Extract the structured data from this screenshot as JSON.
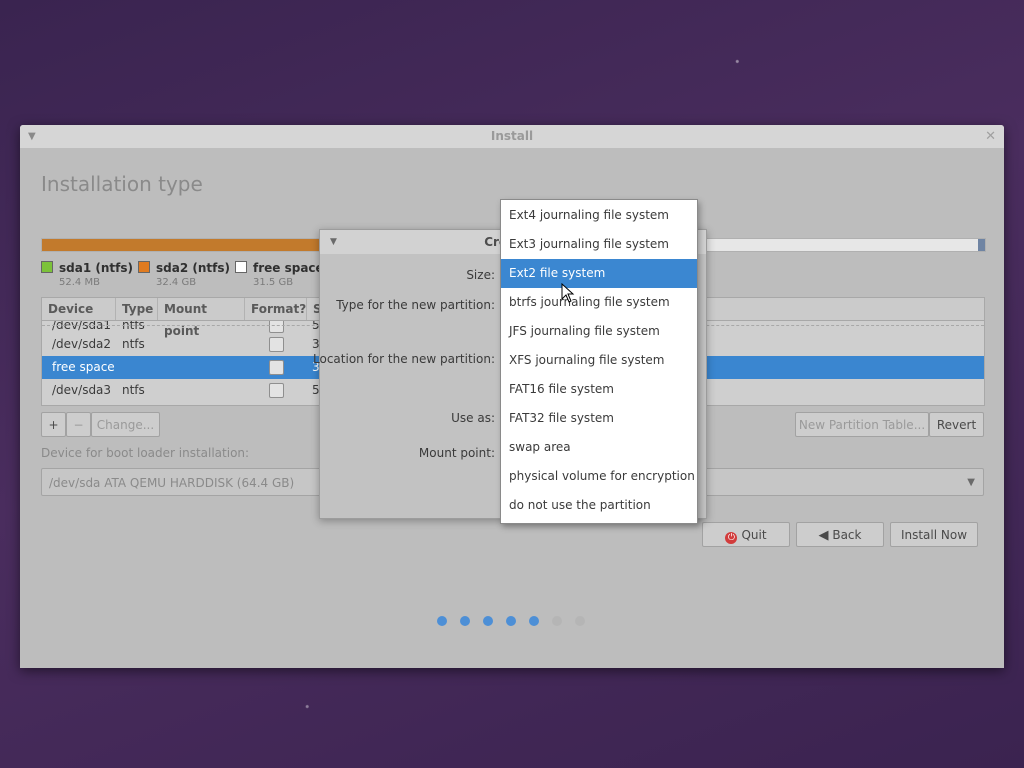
{
  "window": {
    "title": "Install"
  },
  "page": {
    "title": "Installation type"
  },
  "legend": [
    {
      "name": "sda1 (ntfs)",
      "size": "52.4 MB",
      "color": "#7cc23a"
    },
    {
      "name": "sda2 (ntfs)",
      "size": "32.4 GB",
      "color": "#e07b20"
    },
    {
      "name": "free space",
      "size": "31.5 GB",
      "color": "#ffffff"
    }
  ],
  "table": {
    "headers": {
      "device": "Device",
      "type": "Type",
      "mount": "Mount point",
      "format": "Format?",
      "size": "S"
    },
    "rows": [
      {
        "device": "/dev/sda1",
        "type": "ntfs",
        "size": "5"
      },
      {
        "device": "/dev/sda2",
        "type": "ntfs",
        "size": "3"
      },
      {
        "device": "free space",
        "type": "",
        "size": "3"
      },
      {
        "device": "/dev/sda3",
        "type": "ntfs",
        "size": "5"
      }
    ]
  },
  "buttons": {
    "add": "+",
    "remove": "−",
    "change": "Change...",
    "new_table": "New Partition Table...",
    "revert": "Revert",
    "quit": "Quit",
    "back": "Back",
    "install": "Install Now"
  },
  "bootloader": {
    "label": "Device for boot loader installation:",
    "value": "/dev/sda    ATA QEMU HARDDISK (64.4 GB)"
  },
  "progress": {
    "steps_total": 7,
    "steps_done": 5
  },
  "dialog": {
    "title": "Create p",
    "labels": {
      "size": "Size:",
      "type": "Type for the new partition:",
      "location": "Location for the new partition:",
      "use_as": "Use as:",
      "mount": "Mount point:"
    }
  },
  "dropdown": {
    "selected_index": 2,
    "options": [
      "Ext4 journaling file system",
      "Ext3 journaling file system",
      "Ext2 file system",
      "btrfs journaling file system",
      "JFS journaling file system",
      "XFS journaling file system",
      "FAT16 file system",
      "FAT32 file system",
      "swap area",
      "physical volume for encryption",
      "do not use the partition"
    ]
  },
  "colors": {
    "accent": "#3b87d1",
    "partition_orange": "#c27a2c",
    "dot_active": "#4d8fd6",
    "dot_inactive": "#b5b5b5"
  }
}
